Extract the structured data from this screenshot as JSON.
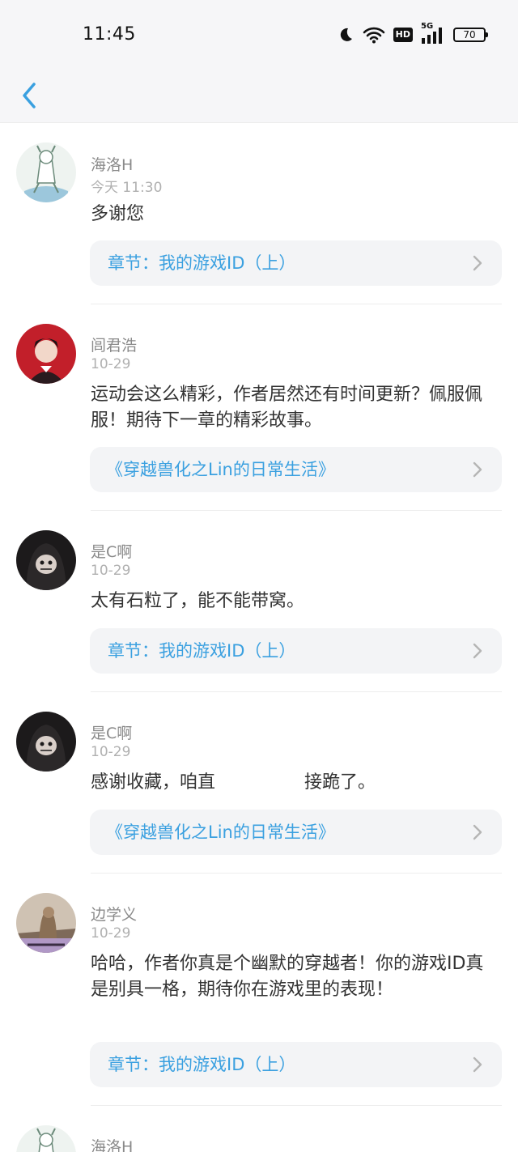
{
  "status_bar": {
    "time": "11:45",
    "icons": [
      "moon-icon",
      "wifi-icon",
      "hd-icon",
      "signal-5g-icon"
    ],
    "hd_label": "HD",
    "net_label": "5G",
    "battery": "70"
  },
  "nav": {
    "back_icon": "chevron-left-icon"
  },
  "colors": {
    "accent": "#3aa0e0",
    "link_bg": "#f3f4f6"
  },
  "comments": [
    {
      "name": "海洛H",
      "date": "今天 11:30",
      "text": "多谢您",
      "link": "章节：我的游戏ID（上）"
    },
    {
      "name": "闾君浩",
      "date": "10-29",
      "text": "运动会这么精彩，作者居然还有时间更新？佩服佩服！期待下一章的精彩故事。",
      "link": "《穿越兽化之Lin的日常生活》"
    },
    {
      "name": "是C啊",
      "date": "10-29",
      "text": "太有石粒了，能不能带窝。",
      "link": "章节：我的游戏ID（上）"
    },
    {
      "name": "是C啊",
      "date": "10-29",
      "text": "感谢收藏，咱直　　　　　接跪了。",
      "link": "《穿越兽化之Lin的日常生活》"
    },
    {
      "name": "边学义",
      "date": "10-29",
      "text": "哈哈，作者你真是个幽默的穿越者！你的游戏ID真是别具一格，期待你在游戏里的表现！",
      "link": "章节：我的游戏ID（上）"
    },
    {
      "name": "海洛H",
      "date": "",
      "text": "",
      "link": ""
    }
  ]
}
